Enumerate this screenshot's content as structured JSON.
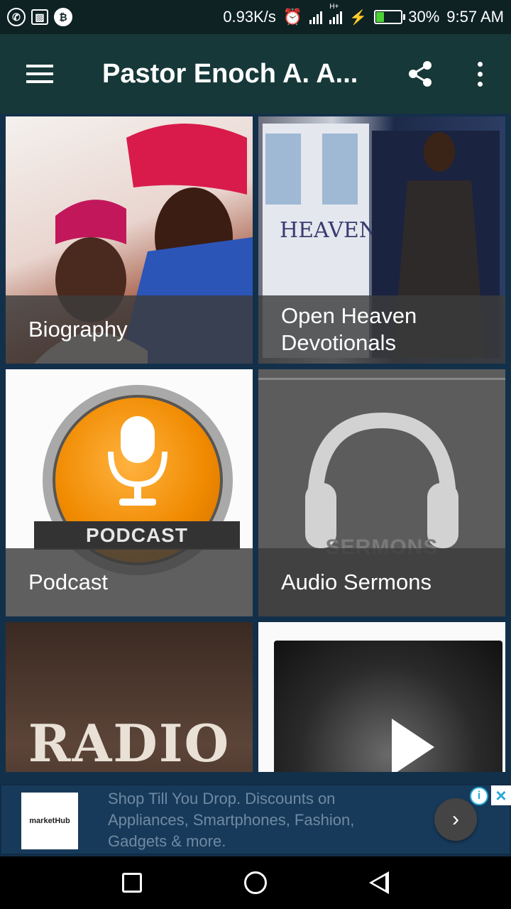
{
  "status_bar": {
    "network_speed": "0.93K/s",
    "network_type": "H+",
    "battery_percent": "30%",
    "time": "9:57 AM",
    "notification_icons": [
      "whatsapp-icon",
      "image-icon",
      "bitcoin-icon"
    ],
    "battery_level": 0.3
  },
  "app_bar": {
    "title": "Pastor Enoch  A. A...",
    "menu_icon": "hamburger-menu-icon",
    "share_icon": "share-icon",
    "more_icon": "more-vert-icon"
  },
  "tiles": [
    {
      "label": "Biography"
    },
    {
      "label": "Open Heaven Devotionals"
    },
    {
      "label": "Podcast",
      "image_text": "PODCAST"
    },
    {
      "label": "Audio Sermons",
      "image_text": "SERMONS"
    },
    {
      "label": "",
      "image_text": "RADIO"
    },
    {
      "label": ""
    }
  ],
  "ad": {
    "advertiser": "marketHub",
    "text": "Shop Till You Drop. Discounts on Appliances, Smartphones, Fashion, Gadgets & more.",
    "info_icon": "info-icon",
    "close_icon": "close-icon",
    "go_icon": "chevron-right-icon"
  },
  "nav_bar": {
    "recent_icon": "recent-apps-icon",
    "home_icon": "home-icon",
    "back_icon": "back-icon"
  }
}
